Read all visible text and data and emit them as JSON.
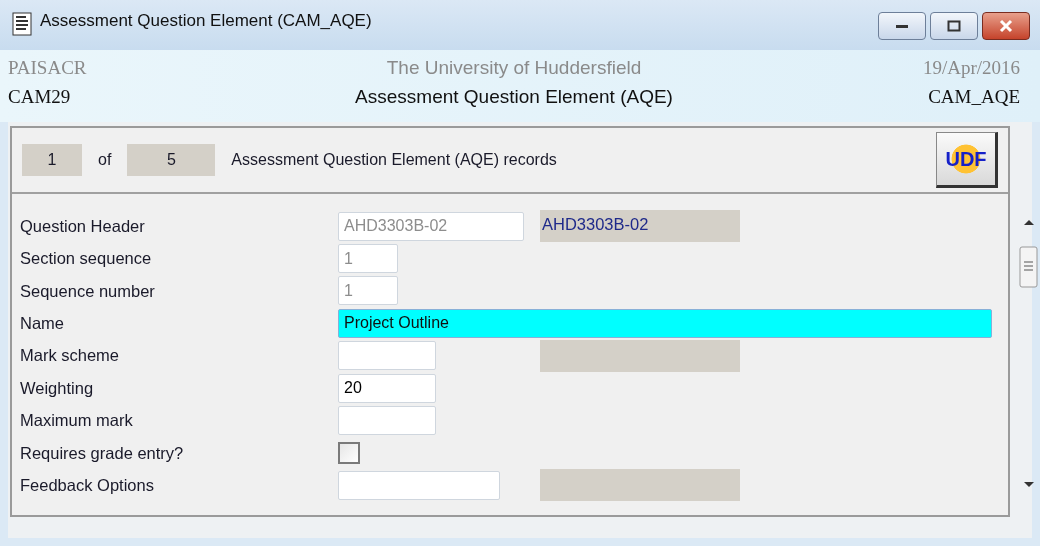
{
  "window": {
    "title": "Assessment Question Element (CAM_AQE)"
  },
  "header": {
    "system": "PAISACR",
    "institution": "The University of Huddersfield",
    "date": "19/Apr/2016",
    "module": "CAM29",
    "screen_title": "Assessment Question Element (AQE)",
    "screen_code": "CAM_AQE"
  },
  "record_bar": {
    "current": "1",
    "of_label": "of",
    "total": "5",
    "caption": "Assessment Question Element (AQE) records",
    "udf_button": "UDF"
  },
  "fields": [
    {
      "label": "Question Header",
      "kind": "text",
      "value": "AHD3303B-02",
      "disabled": true,
      "focused": false,
      "lookup": true,
      "lookup_value": "AHD3303B-02"
    },
    {
      "label": "Section sequence",
      "kind": "text",
      "value": "1",
      "disabled": true,
      "focused": false,
      "lookup": false
    },
    {
      "label": "Sequence number",
      "kind": "text",
      "value": "1",
      "disabled": true,
      "focused": false,
      "lookup": false
    },
    {
      "label": "Name",
      "kind": "text",
      "value": "Project Outline",
      "disabled": false,
      "focused": true,
      "lookup": false
    },
    {
      "label": "Mark scheme",
      "kind": "text",
      "focused": false,
      "lookup": true
    },
    {
      "label": "Weighting",
      "kind": "text",
      "value": "20",
      "disabled": false,
      "focused": false,
      "lookup": false
    },
    {
      "label": "Maximum mark",
      "kind": "text",
      "focused": false,
      "lookup": false
    },
    {
      "label": "Requires grade entry?",
      "kind": "checkbox",
      "checked": false
    },
    {
      "label": "Feedback Options",
      "kind": "text",
      "focused": false,
      "lookup": true
    }
  ]
}
